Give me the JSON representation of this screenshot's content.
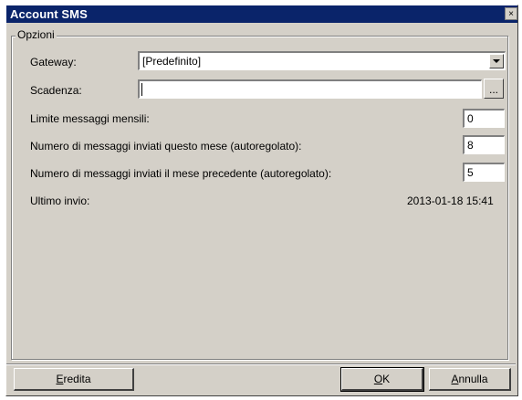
{
  "window": {
    "title": "Account SMS",
    "close_glyph": "×"
  },
  "group": {
    "legend": "Opzioni"
  },
  "fields": {
    "gateway_label": "Gateway:",
    "gateway_value": "[Predefinito]",
    "scadenza_label": "Scadenza:",
    "scadenza_value": "",
    "browse_label": "...",
    "limite_label": "Limite messaggi mensili:",
    "limite_value": "0",
    "inviati_mese_label": "Numero di messaggi inviati questo mese (autoregolato):",
    "inviati_mese_value": "8",
    "inviati_prec_label": "Numero di messaggi inviati il mese precedente (autoregolato):",
    "inviati_prec_value": "5",
    "ultimo_invio_label": "Ultimo invio:",
    "ultimo_invio_value": "2013-01-18 15:41"
  },
  "buttons": {
    "eredita_mnemonic": "E",
    "eredita_rest": "redita",
    "ok_mnemonic": "O",
    "ok_rest": "K",
    "annulla_mnemonic": "A",
    "annulla_rest": "nnulla"
  },
  "icons": {
    "close": "close-icon",
    "dropdown": "chevron-down-icon"
  }
}
